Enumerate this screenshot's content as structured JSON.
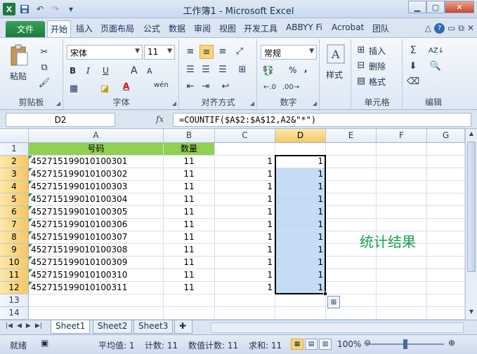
{
  "window": {
    "title": "工作簿1 - Microsoft Excel",
    "app_letter": "X"
  },
  "tabs": {
    "file": "文件",
    "items": [
      "开始",
      "插入",
      "页面布局",
      "公式",
      "数据",
      "审阅",
      "视图",
      "开发工具",
      "ABBYY Fi",
      "Acrobat",
      "团队"
    ]
  },
  "ribbon": {
    "clipboard": {
      "label": "剪贴板",
      "paste": "粘贴"
    },
    "font": {
      "label": "字体",
      "name": "宋体",
      "size": "11",
      "bold": "B",
      "italic": "I",
      "underline": "U",
      "grow": "A",
      "shrink": "A",
      "wen": "wén"
    },
    "alignment": {
      "label": "对齐方式"
    },
    "number": {
      "label": "数字",
      "format": "常规",
      "percent": "%",
      "comma": ","
    },
    "styles": {
      "label": "样式"
    },
    "cells": {
      "label": "单元格",
      "insert": "插入",
      "delete": "删除",
      "format": "格式"
    },
    "editing": {
      "label": "编辑"
    }
  },
  "formula_bar": {
    "name_box": "D2",
    "fx": "fx",
    "formula": "=COUNTIF($A$2:$A$12,A2&\"*\")"
  },
  "grid": {
    "columns": [
      "A",
      "B",
      "C",
      "D",
      "E",
      "F",
      "G"
    ],
    "rows": [
      "1",
      "2",
      "3",
      "4",
      "5",
      "6",
      "7",
      "8",
      "9",
      "10",
      "11",
      "12",
      "13",
      "14"
    ],
    "header": {
      "a": "号码",
      "b": "数量"
    },
    "data": [
      {
        "a": "452715199010100301",
        "b": "11",
        "c": "1",
        "d": "1"
      },
      {
        "a": "452715199010100302",
        "b": "11",
        "c": "1",
        "d": "1"
      },
      {
        "a": "452715199010100303",
        "b": "11",
        "c": "1",
        "d": "1"
      },
      {
        "a": "452715199010100304",
        "b": "11",
        "c": "1",
        "d": "1"
      },
      {
        "a": "452715199010100305",
        "b": "11",
        "c": "1",
        "d": "1"
      },
      {
        "a": "452715199010100306",
        "b": "11",
        "c": "1",
        "d": "1"
      },
      {
        "a": "452715199010100307",
        "b": "11",
        "c": "1",
        "d": "1"
      },
      {
        "a": "452715199010100308",
        "b": "11",
        "c": "1",
        "d": "1"
      },
      {
        "a": "452715199010100309",
        "b": "11",
        "c": "1",
        "d": "1"
      },
      {
        "a": "452715199010100310",
        "b": "11",
        "c": "1",
        "d": "1"
      },
      {
        "a": "452715199010100311",
        "b": "11",
        "c": "1",
        "d": "1"
      }
    ],
    "annotation": "统计结果",
    "colors": {
      "header_fill": "#92d050",
      "selection_fill": "#c5dcf7",
      "annotation": "#1aa050"
    }
  },
  "sheets": [
    "Sheet1",
    "Sheet2",
    "Sheet3"
  ],
  "status": {
    "mode": "就绪",
    "average": "平均值: 1",
    "count": "计数: 11",
    "numeric_count": "数值计数: 11",
    "sum": "求和: 11",
    "zoom": "100%"
  }
}
